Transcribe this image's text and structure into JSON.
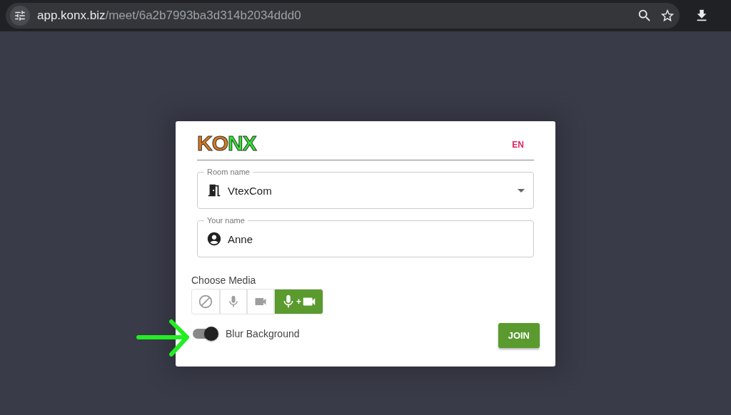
{
  "browser": {
    "url_host": "app.konx.biz",
    "url_path": "/meet/6a2b7993ba3d314b2034ddd0"
  },
  "card": {
    "logo_text": "KONX",
    "language": "EN",
    "room": {
      "label": "Room name",
      "value": "VtexCom"
    },
    "name": {
      "label": "Your name",
      "value": "Anne"
    },
    "media_title": "Choose Media",
    "media_options": [
      {
        "kind": "none",
        "selected": false
      },
      {
        "kind": "mic",
        "selected": false
      },
      {
        "kind": "camera",
        "selected": false
      },
      {
        "kind": "mic_camera",
        "joiner": "+",
        "selected": true
      }
    ],
    "blur": {
      "label": "Blur Background",
      "on": true
    },
    "join": "JOIN"
  }
}
